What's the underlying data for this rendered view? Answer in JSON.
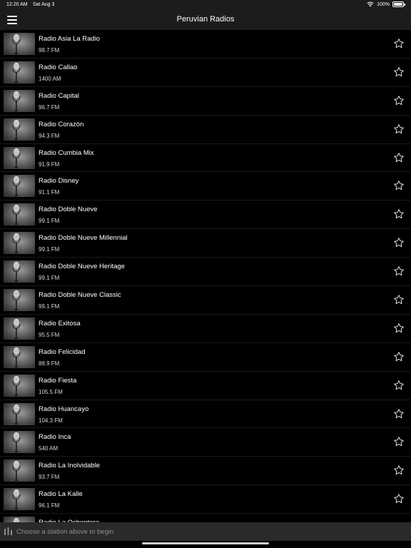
{
  "status_bar": {
    "time": "12:20 AM",
    "date": "Sat Aug 3",
    "battery": "100%"
  },
  "nav": {
    "title": "Peruvian Radios"
  },
  "stations": [
    {
      "name": "Radio Asia La Radio",
      "freq": "98.7 FM"
    },
    {
      "name": "Radio Callao",
      "freq": "1400 AM"
    },
    {
      "name": "Radio Capital",
      "freq": "96.7 FM"
    },
    {
      "name": "Radio Corazón",
      "freq": "94.3 FM"
    },
    {
      "name": "Radio Cumbia Mix",
      "freq": "91.9 FM"
    },
    {
      "name": "Radio Disney",
      "freq": "91.1 FM"
    },
    {
      "name": "Radio Doble Nueve",
      "freq": "99.1 FM"
    },
    {
      "name": "Radio Doble Nueve Millennial",
      "freq": "99.1 FM"
    },
    {
      "name": "Radio Doble Nueve Heritage",
      "freq": "99.1 FM"
    },
    {
      "name": "Radio Doble Nueve Classic",
      "freq": "99.1 FM"
    },
    {
      "name": "Radio Exitosa",
      "freq": "95.5 FM"
    },
    {
      "name": "Radio Felicidad",
      "freq": "88.9 FM"
    },
    {
      "name": "Radio Fiesta",
      "freq": "105.5 FM"
    },
    {
      "name": "Radio Huancayo",
      "freq": "104.3 FM"
    },
    {
      "name": "Radio Inca",
      "freq": "540 AM"
    },
    {
      "name": "Radio La Inolvidable",
      "freq": "93.7 FM"
    },
    {
      "name": "Radio La Kalle",
      "freq": "96.1 FM"
    },
    {
      "name": "Radio La Ochentera",
      "freq": ""
    }
  ],
  "player": {
    "prompt": "Choose a station above to begin"
  },
  "icons": {
    "menu": "hamburger-icon",
    "star": "star-outline-icon",
    "thumbnail": "microphone-icon",
    "player": "equalizer-icon"
  },
  "colors": {
    "background": "#000000",
    "bars": "#1c1c1e",
    "player_bar": "#2a2a2c",
    "muted_text": "#8e8e93"
  }
}
